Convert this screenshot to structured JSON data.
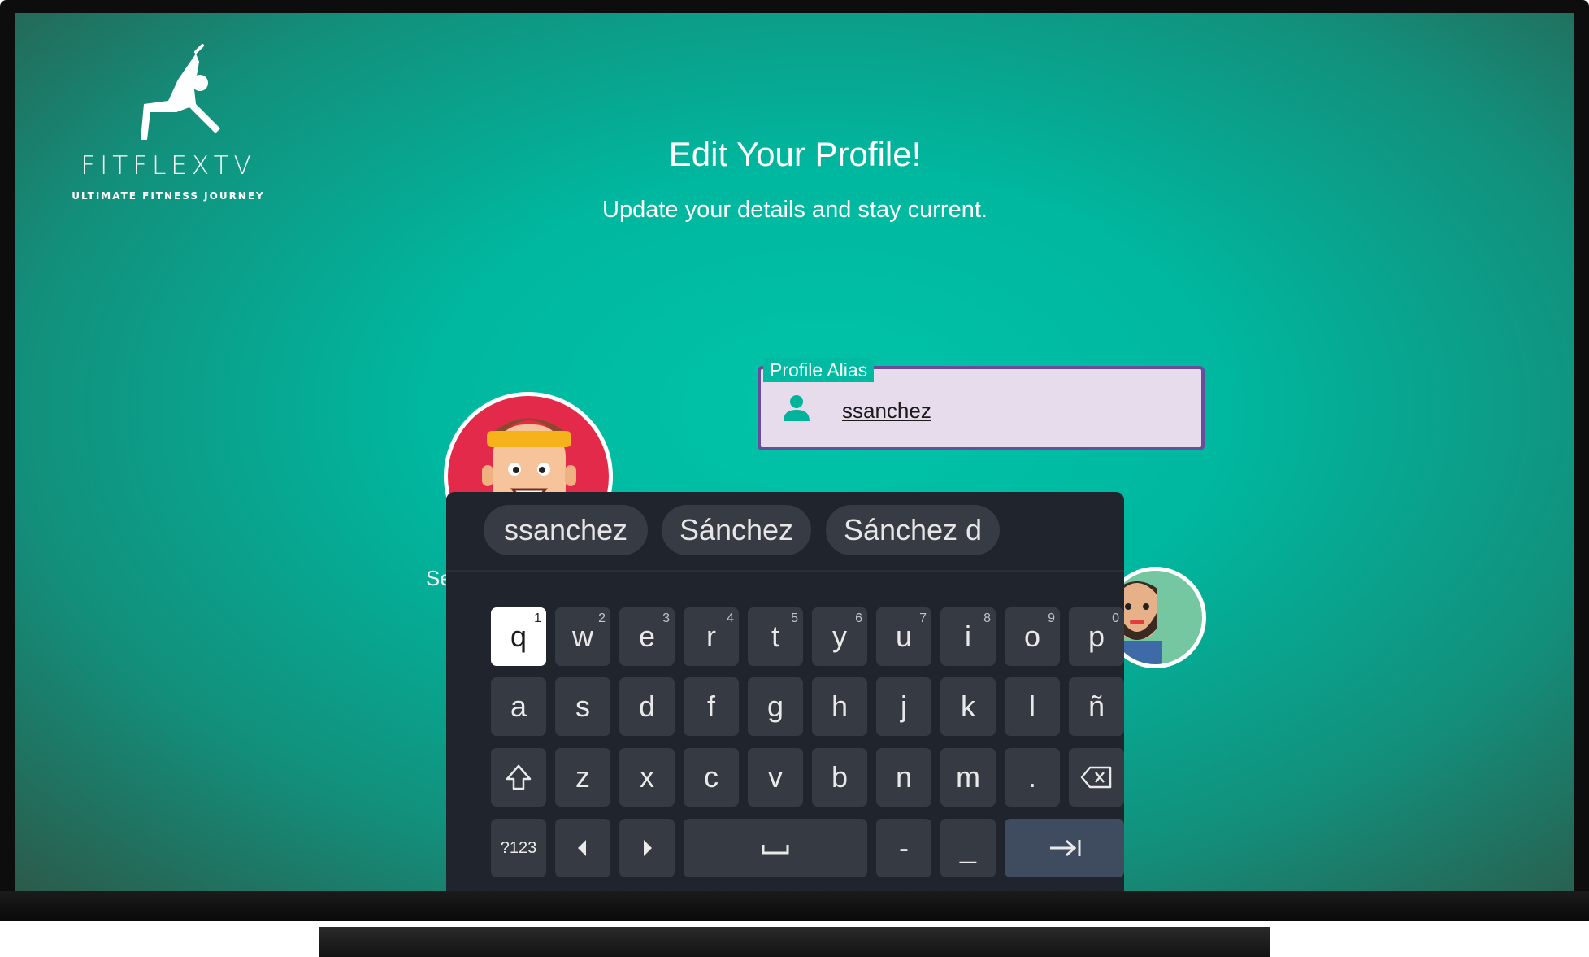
{
  "app": {
    "brand": "FITFLEXTV",
    "tagline": "ULTIMATE FITNESS JOURNEY"
  },
  "header": {
    "title": "Edit Your Profile!",
    "subtitle": "Update your details and stay current."
  },
  "profile_field": {
    "label": "Profile Alias",
    "value": "ssanchez",
    "icon": "person-icon"
  },
  "avatars": {
    "partial_label": "Se"
  },
  "keyboard": {
    "suggestions": [
      "ssanchez",
      "Sánchez",
      "Sánchez d"
    ],
    "row1": [
      {
        "label": "q",
        "hint": "1"
      },
      {
        "label": "w",
        "hint": "2"
      },
      {
        "label": "e",
        "hint": "3"
      },
      {
        "label": "r",
        "hint": "4"
      },
      {
        "label": "t",
        "hint": "5"
      },
      {
        "label": "y",
        "hint": "6"
      },
      {
        "label": "u",
        "hint": "7"
      },
      {
        "label": "i",
        "hint": "8"
      },
      {
        "label": "o",
        "hint": "9"
      },
      {
        "label": "p",
        "hint": "0"
      }
    ],
    "row2": [
      "a",
      "s",
      "d",
      "f",
      "g",
      "h",
      "j",
      "k",
      "l",
      "ñ"
    ],
    "row3": [
      "z",
      "x",
      "c",
      "v",
      "b",
      "n",
      "m",
      "."
    ],
    "row4": {
      "symbols": "?123",
      "dash": "-",
      "underscore": "_"
    },
    "focused_key": "q",
    "colors": {
      "background": "#20242c",
      "key": "#363a42",
      "enter": "#3f4b5e"
    }
  },
  "colors": {
    "screen": "#00bba2",
    "field_bg": "#e7dcec",
    "field_border": "#6a4c9c"
  }
}
